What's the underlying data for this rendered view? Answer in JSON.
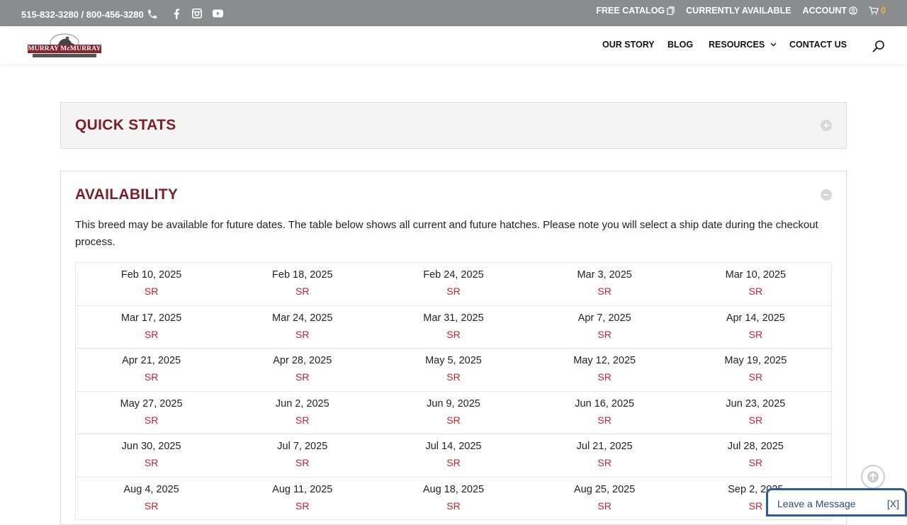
{
  "topbar": {
    "phone": "515-832-3280 / 800-456-3280",
    "free_catalog": "FREE CATALOG",
    "currently_available": "CURRENTLY AVAILABLE",
    "account": "ACCOUNT",
    "cart_count": "0"
  },
  "brand": {
    "logo_text": "MURRAY McMURRAY"
  },
  "nav": {
    "our_story": "OUR STORY",
    "blog": "BLOG",
    "resources": "RESOURCES",
    "contact_us": "CONTACT US"
  },
  "quick_stats": {
    "title": "QUICK STATS"
  },
  "availability": {
    "title": "AVAILABILITY",
    "intro": "This breed may be available for future dates. The table below shows all current and future hatches. Please note you will select a ship date during the checkout process.",
    "rows": [
      [
        {
          "date": "Feb 10, 2025",
          "status": "SR"
        },
        {
          "date": "Feb 18, 2025",
          "status": "SR"
        },
        {
          "date": "Feb 24, 2025",
          "status": "SR"
        },
        {
          "date": "Mar 3, 2025",
          "status": "SR"
        },
        {
          "date": "Mar 10, 2025",
          "status": "SR"
        }
      ],
      [
        {
          "date": "Mar 17, 2025",
          "status": "SR"
        },
        {
          "date": "Mar 24, 2025",
          "status": "SR"
        },
        {
          "date": "Mar 31, 2025",
          "status": "SR"
        },
        {
          "date": "Apr 7, 2025",
          "status": "SR"
        },
        {
          "date": "Apr 14, 2025",
          "status": "SR"
        }
      ],
      [
        {
          "date": "Apr 21, 2025",
          "status": "SR"
        },
        {
          "date": "Apr 28, 2025",
          "status": "SR"
        },
        {
          "date": "May 5, 2025",
          "status": "SR"
        },
        {
          "date": "May 12, 2025",
          "status": "SR"
        },
        {
          "date": "May 19, 2025",
          "status": "SR"
        }
      ],
      [
        {
          "date": "May 27, 2025",
          "status": "SR"
        },
        {
          "date": "Jun 2, 2025",
          "status": "SR"
        },
        {
          "date": "Jun 9, 2025",
          "status": "SR"
        },
        {
          "date": "Jun 16, 2025",
          "status": "SR"
        },
        {
          "date": "Jun 23, 2025",
          "status": "SR"
        }
      ],
      [
        {
          "date": "Jun 30, 2025",
          "status": "SR"
        },
        {
          "date": "Jul 7, 2025",
          "status": "SR"
        },
        {
          "date": "Jul 14, 2025",
          "status": "SR"
        },
        {
          "date": "Jul 21, 2025",
          "status": "SR"
        },
        {
          "date": "Jul 28, 2025",
          "status": "SR"
        }
      ],
      [
        {
          "date": "Aug 4, 2025",
          "status": "SR"
        },
        {
          "date": "Aug 11, 2025",
          "status": "SR"
        },
        {
          "date": "Aug 18, 2025",
          "status": "SR"
        },
        {
          "date": "Aug 25, 2025",
          "status": "SR"
        },
        {
          "date": "Sep 2, 2025",
          "status": "SR"
        }
      ]
    ]
  },
  "chat": {
    "label": "Leave a Message",
    "close": "[X]"
  },
  "icons": {
    "phone": "phone-icon",
    "facebook": "facebook-icon",
    "instagram": "instagram-icon",
    "youtube": "youtube-icon",
    "catalog": "catalog-icon",
    "account": "account-icon",
    "cart": "cart-icon",
    "search": "search-icon",
    "expand": "plus-circle-icon",
    "collapse": "minus-circle-icon",
    "scroll_top": "arrow-up-icon"
  },
  "colors": {
    "topbar": "#8b8c8e",
    "heading": "#7c1f2a",
    "status": "#c8202f",
    "cart_count": "#f2b632",
    "chat_border": "#2b5a9e"
  }
}
